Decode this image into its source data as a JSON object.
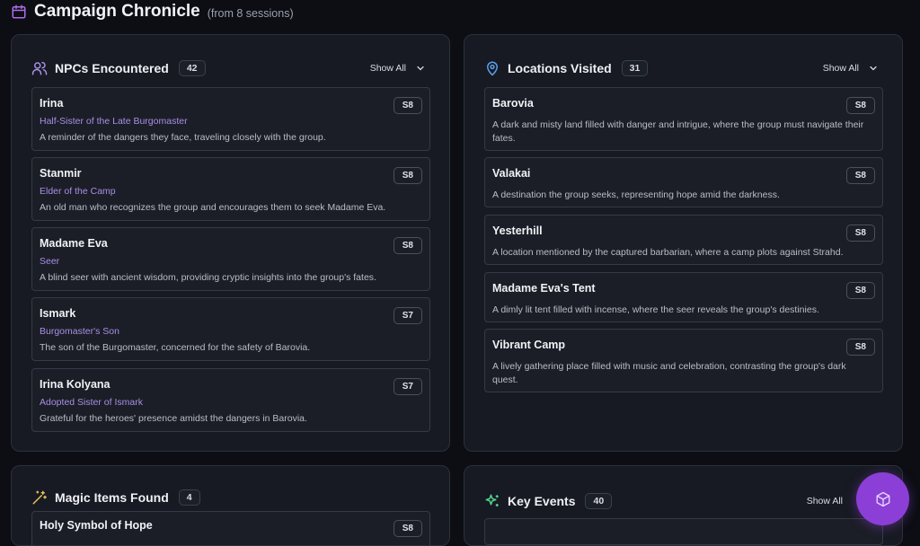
{
  "header": {
    "title": "Campaign Chronicle",
    "subtitle": "(from 8 sessions)"
  },
  "npcs": {
    "title": "NPCs Encountered",
    "count": "42",
    "show_all": "Show All",
    "items": [
      {
        "name": "Irina",
        "role": "Half-Sister of the Late Burgomaster",
        "desc": "A reminder of the dangers they face, traveling closely with the group.",
        "session": "S8"
      },
      {
        "name": "Stanmir",
        "role": "Elder of the Camp",
        "desc": "An old man who recognizes the group and encourages them to seek Madame Eva.",
        "session": "S8"
      },
      {
        "name": "Madame Eva",
        "role": "Seer",
        "desc": "A blind seer with ancient wisdom, providing cryptic insights into the group's fates.",
        "session": "S8"
      },
      {
        "name": "Ismark",
        "role": "Burgomaster's Son",
        "desc": "The son of the Burgomaster, concerned for the safety of Barovia.",
        "session": "S7"
      },
      {
        "name": "Irina Kolyana",
        "role": "Adopted Sister of Ismark",
        "desc": "Grateful for the heroes' presence amidst the dangers in Barovia.",
        "session": "S7"
      }
    ]
  },
  "locations": {
    "title": "Locations Visited",
    "count": "31",
    "show_all": "Show All",
    "items": [
      {
        "name": "Barovia",
        "desc": "A dark and misty land filled with danger and intrigue, where the group must navigate their fates.",
        "session": "S8"
      },
      {
        "name": "Valakai",
        "desc": "A destination the group seeks, representing hope amid the darkness.",
        "session": "S8"
      },
      {
        "name": "Yesterhill",
        "desc": "A location mentioned by the captured barbarian, where a camp plots against Strahd.",
        "session": "S8"
      },
      {
        "name": "Madame Eva's Tent",
        "desc": "A dimly lit tent filled with incense, where the seer reveals the group's destinies.",
        "session": "S8"
      },
      {
        "name": "Vibrant Camp",
        "desc": "A lively gathering place filled with music and celebration, contrasting the group's dark quest.",
        "session": "S8"
      }
    ]
  },
  "items": {
    "title": "Magic Items Found",
    "count": "4",
    "first": {
      "name": "Holy Symbol of Hope",
      "session": "S8"
    }
  },
  "events": {
    "title": "Key Events",
    "count": "40",
    "show_all": "Show All"
  },
  "colors": {
    "accent_purple": "#8b3fd6",
    "role_text": "#a98ee8",
    "location_icon": "#5aa0f0",
    "items_icon": "#e8c15a",
    "events_icon": "#4fd18b"
  },
  "icons": {
    "header": "calendar-icon",
    "npcs": "users-icon",
    "locations": "map-pin-icon",
    "items": "wand-sparkles-icon",
    "events": "sparkles-icon",
    "fab": "dice-icon"
  }
}
